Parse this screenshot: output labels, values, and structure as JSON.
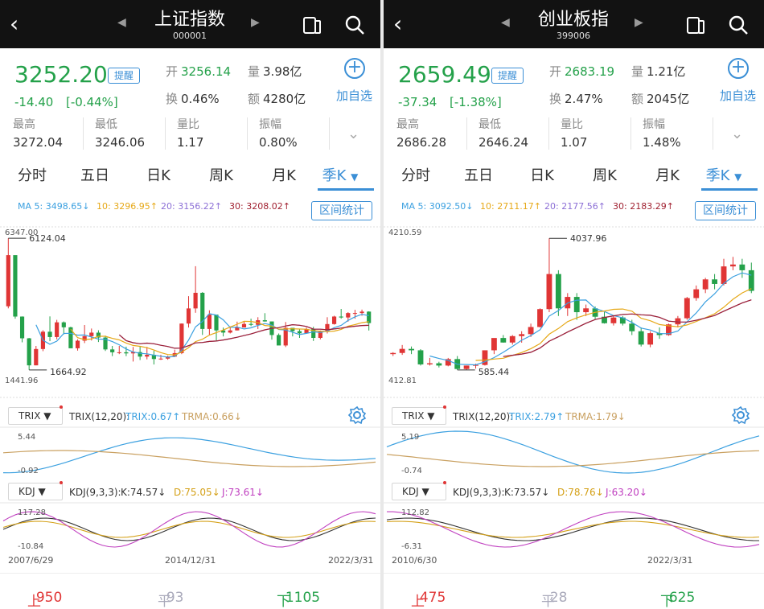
{
  "panels": [
    {
      "header": {
        "title": "上证指数",
        "code": "000001"
      },
      "quote": {
        "price": "3252.20",
        "change": "-14.40",
        "change_pct": "[-0.44%]",
        "remind_label": "提醒",
        "open_label": "开",
        "open": "3256.14",
        "volume_label": "量",
        "volume": "3.98亿",
        "turnover_label": "换",
        "turnover": "0.46%",
        "amount_label": "额",
        "amount": "4280亿",
        "add_label": "加自选"
      },
      "stats": {
        "high_label": "最高",
        "high": "3272.04",
        "low_label": "最低",
        "low": "3246.06",
        "ratio_label": "量比",
        "ratio": "1.17",
        "amp_label": "振幅",
        "amp": "0.80%"
      },
      "tabs": [
        "分时",
        "五日",
        "日K",
        "周K",
        "月K",
        "季K"
      ],
      "ma": {
        "ma5": "MA 5: 3498.65↓",
        "ma10": "10: 3296.95↑",
        "ma20": "20: 3156.22↑",
        "ma30": "30: 3208.02↑",
        "range_label": "区间统计"
      },
      "main_labels": {
        "top": "6347.00",
        "bottom": "1441.96",
        "max": "6124.04",
        "min": "1664.92"
      },
      "trix": {
        "selector": "TRIX",
        "params": "TRIX(12,20):",
        "trix": "TRIX:0.67↑",
        "trma": "TRMA:0.66↓",
        "top": "5.44",
        "bottom": "-0.92"
      },
      "kdj": {
        "selector": "KDJ",
        "params": "KDJ(9,3,3):",
        "k": "K:74.57↓",
        "d": "D:75.05↓",
        "j": "J:73.61↓",
        "top": "117.28",
        "bottom": "-10.84"
      },
      "dates": {
        "start": "2007/6/29",
        "mid": "2014/12/31",
        "end": "2022/3/31"
      },
      "footer": {
        "up": "上涨",
        "up_count": "950家",
        "flat": "平盘",
        "flat_count": "93家",
        "down": "下跌",
        "down_count": "1105家"
      }
    },
    {
      "header": {
        "title": "创业板指",
        "code": "399006"
      },
      "quote": {
        "price": "2659.49",
        "change": "-37.34",
        "change_pct": "[-1.38%]",
        "remind_label": "提醒",
        "open_label": "开",
        "open": "2683.19",
        "volume_label": "量",
        "volume": "1.21亿",
        "turnover_label": "换",
        "turnover": "2.47%",
        "amount_label": "额",
        "amount": "2045亿",
        "add_label": "加自选"
      },
      "stats": {
        "high_label": "最高",
        "high": "2686.28",
        "low_label": "最低",
        "low": "2646.24",
        "ratio_label": "量比",
        "ratio": "1.07",
        "amp_label": "振幅",
        "amp": "1.48%"
      },
      "tabs": [
        "分时",
        "五日",
        "日K",
        "周K",
        "月K",
        "季K"
      ],
      "ma": {
        "ma5": "MA 5: 3092.50↓",
        "ma10": "10: 2711.17↑",
        "ma20": "20: 2177.56↑",
        "ma30": "30: 2183.29↑",
        "range_label": "区间统计"
      },
      "main_labels": {
        "top": "4210.59",
        "bottom": "412.81",
        "max": "4037.96",
        "min": "585.44"
      },
      "trix": {
        "selector": "TRIX",
        "params": "TRIX(12,20):",
        "trix": "TRIX:2.79↑",
        "trma": "TRMA:1.79↓",
        "top": "5.19",
        "bottom": "-0.74"
      },
      "kdj": {
        "selector": "KDJ",
        "params": "KDJ(9,3,3):",
        "k": "K:73.57↓",
        "d": "D:78.76↓",
        "j": "J:63.20↓",
        "top": "112.82",
        "bottom": "-6.31"
      },
      "dates": {
        "start": "2010/6/30",
        "end": "2022/3/31"
      },
      "footer": {
        "up": "上涨",
        "up_count": "475家",
        "flat": "平盘",
        "flat_count": "28家",
        "down": "下跌",
        "down_count": "625家"
      }
    }
  ],
  "colors": {
    "up": "#e03535",
    "down": "#24a14a",
    "accent": "#3b8fd6",
    "ma5": "#3ba0e0",
    "ma10": "#e6a817",
    "ma20": "#8c6fd6",
    "ma30": "#a02030"
  },
  "chart_data": [
    {
      "type": "candlestick",
      "name": "上证指数 季K",
      "y_range": [
        1441.96,
        6347.0
      ],
      "ohlc": [
        [
          3820,
          6124,
          3750,
          5554
        ],
        [
          5554,
          5522,
          3400,
          3472
        ],
        [
          3472,
          3478,
          2600,
          2736
        ],
        [
          2736,
          2748,
          1664,
          1820
        ],
        [
          1820,
          2478,
          1820,
          2373
        ],
        [
          2373,
          3010,
          2300,
          2959
        ],
        [
          2959,
          3478,
          2639,
          2779
        ],
        [
          2779,
          3361,
          2700,
          3277
        ],
        [
          3277,
          3306,
          2870,
          3109
        ],
        [
          3109,
          3127,
          2481,
          2398
        ],
        [
          2398,
          2700,
          2319,
          2655
        ],
        [
          2655,
          3186,
          2574,
          2808
        ],
        [
          2808,
          3067,
          2661,
          2928
        ],
        [
          2928,
          3008,
          2610,
          2762
        ],
        [
          2762,
          2826,
          2307,
          2359
        ],
        [
          2359,
          2478,
          2132,
          2262
        ],
        [
          2262,
          2478,
          2200,
          2262
        ],
        [
          2262,
          2453,
          2132,
          2225
        ],
        [
          2225,
          2444,
          1949,
          2269
        ],
        [
          2269,
          2478,
          2000,
          2116
        ],
        [
          2116,
          2444,
          2023,
          2178
        ],
        [
          2178,
          2318,
          1849,
          2033
        ],
        [
          2033,
          2177,
          2004,
          2048
        ],
        [
          2048,
          2148,
          2010,
          2115
        ],
        [
          2115,
          2350,
          2100,
          2234
        ],
        [
          2234,
          3239,
          2200,
          3235
        ],
        [
          3235,
          4164,
          3100,
          3748
        ],
        [
          3748,
          5178,
          3600,
          4277
        ],
        [
          4277,
          4300,
          2850,
          3053
        ],
        [
          3053,
          3684,
          2850,
          3539
        ],
        [
          3539,
          3540,
          2638,
          3003
        ],
        [
          3003,
          3100,
          2800,
          2930
        ],
        [
          2930,
          3140,
          2900,
          3004
        ],
        [
          3004,
          3301,
          3000,
          3103
        ],
        [
          3103,
          3300,
          3100,
          3222
        ],
        [
          3222,
          3400,
          3150,
          3192
        ],
        [
          3192,
          3450,
          3050,
          3348
        ],
        [
          3348,
          3587,
          3300,
          3307
        ],
        [
          3307,
          3200,
          2690,
          2847
        ],
        [
          2847,
          2900,
          2644,
          2493
        ],
        [
          2493,
          3288,
          2440,
          3090
        ],
        [
          3090,
          3000,
          2800,
          2978
        ],
        [
          2978,
          3050,
          2750,
          2905
        ],
        [
          2905,
          3100,
          2900,
          3050
        ],
        [
          3050,
          3127,
          2646,
          2750
        ],
        [
          2750,
          3000,
          2700,
          2985
        ],
        [
          2985,
          3450,
          2900,
          3218
        ],
        [
          3218,
          3500,
          3200,
          3473
        ],
        [
          3473,
          3731,
          3400,
          3441
        ],
        [
          3441,
          3620,
          3300,
          3591
        ],
        [
          3591,
          3700,
          3400,
          3592
        ],
        [
          3592,
          3708,
          3500,
          3640
        ],
        [
          3640,
          3650,
          3000,
          3252
        ]
      ]
    },
    {
      "type": "candlestick",
      "name": "创业板指 季K",
      "y_range": [
        412.81,
        4210.59
      ],
      "ohlc": [
        [
          1000,
          1050,
          950,
          1030
        ],
        [
          1030,
          1239,
          980,
          1137
        ],
        [
          1137,
          1200,
          1000,
          1100
        ],
        [
          1100,
          1130,
          700,
          730
        ],
        [
          730,
          900,
          700,
          760
        ],
        [
          760,
          800,
          650,
          700
        ],
        [
          700,
          900,
          680,
          870
        ],
        [
          870,
          950,
          585,
          610
        ],
        [
          610,
          700,
          585,
          700
        ],
        [
          700,
          750,
          620,
          715
        ],
        [
          715,
          1100,
          700,
          1100
        ],
        [
          1100,
          1400,
          1000,
          1423
        ],
        [
          1423,
          1500,
          1300,
          1304
        ],
        [
          1304,
          1500,
          1250,
          1472
        ],
        [
          1472,
          1600,
          1300,
          1524
        ],
        [
          1524,
          1800,
          1450,
          1711
        ],
        [
          1711,
          2200,
          1700,
          2180
        ],
        [
          2180,
          4037,
          2100,
          3100
        ],
        [
          3100,
          3200,
          2000,
          2200
        ],
        [
          2200,
          2600,
          2000,
          2500
        ],
        [
          2500,
          2600,
          1900,
          2100
        ],
        [
          2100,
          2300,
          2000,
          2200
        ],
        [
          2200,
          2250,
          1900,
          1980
        ],
        [
          1980,
          2100,
          1800,
          1810
        ],
        [
          1810,
          2000,
          1750,
          1960
        ],
        [
          1960,
          2000,
          1750,
          1800
        ],
        [
          1800,
          1900,
          1500,
          1600
        ],
        [
          1600,
          1700,
          1200,
          1250
        ],
        [
          1250,
          1600,
          1180,
          1550
        ],
        [
          1550,
          1700,
          1400,
          1500
        ],
        [
          1500,
          1800,
          1480,
          1780
        ],
        [
          1780,
          2000,
          1700,
          1940
        ],
        [
          1940,
          2500,
          1900,
          2470
        ],
        [
          2470,
          2800,
          2400,
          2700
        ],
        [
          2700,
          3000,
          2600,
          2960
        ],
        [
          2960,
          3100,
          2700,
          2840
        ],
        [
          2840,
          3500,
          2800,
          3300
        ],
        [
          3300,
          3550,
          3200,
          3350
        ],
        [
          3350,
          3500,
          3000,
          3200
        ],
        [
          3200,
          3400,
          2600,
          2659
        ]
      ]
    }
  ]
}
